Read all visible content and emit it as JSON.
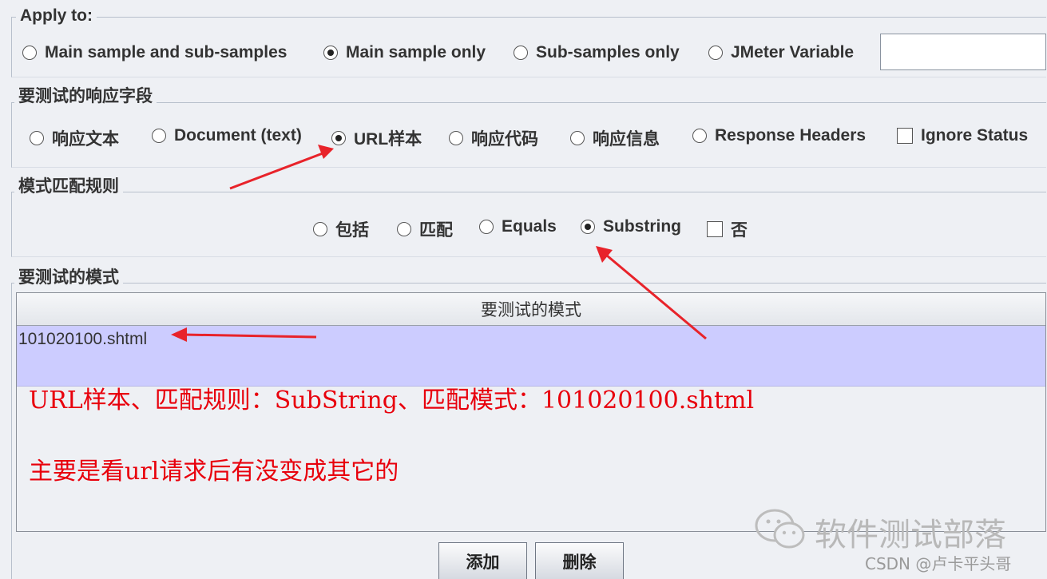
{
  "apply_to": {
    "legend": "Apply to:",
    "options": [
      {
        "label": "Main sample and sub-samples",
        "selected": false
      },
      {
        "label": "Main sample only",
        "selected": true
      },
      {
        "label": "Sub-samples only",
        "selected": false
      },
      {
        "label": "JMeter Variable",
        "selected": false
      }
    ],
    "variable_value": ""
  },
  "response_field": {
    "legend": "要测试的响应字段",
    "options": [
      {
        "label": "响应文本",
        "selected": false
      },
      {
        "label": "Document (text)",
        "selected": false
      },
      {
        "label": "URL样本",
        "selected": true
      },
      {
        "label": "响应代码",
        "selected": false
      },
      {
        "label": "响应信息",
        "selected": false
      },
      {
        "label": "Response Headers",
        "selected": false
      }
    ],
    "ignore_status": {
      "label": "Ignore Status",
      "checked": false
    }
  },
  "pattern_rules": {
    "legend": "模式匹配规则",
    "options": [
      {
        "label": "包括",
        "selected": false
      },
      {
        "label": "匹配",
        "selected": false
      },
      {
        "label": "Equals",
        "selected": false
      },
      {
        "label": "Substring",
        "selected": true
      }
    ],
    "not": {
      "label": "否",
      "checked": false
    }
  },
  "patterns": {
    "legend": "要测试的模式",
    "column_header": "要测试的模式",
    "rows": [
      "101020100.shtml"
    ]
  },
  "annotations": {
    "line1": "URL样本、匹配规则：SubString、匹配模式：101020100.shtml",
    "line2": "主要是看url请求后有没变成其它的",
    "color": "#e8000c"
  },
  "buttons": {
    "add": "添加",
    "delete": "删除"
  },
  "watermark": {
    "brand": "软件测试部落",
    "credit": "CSDN @卢卡平头哥"
  },
  "colors": {
    "selected_row": "#ccccff",
    "panel_bg": "#eef0f4"
  }
}
